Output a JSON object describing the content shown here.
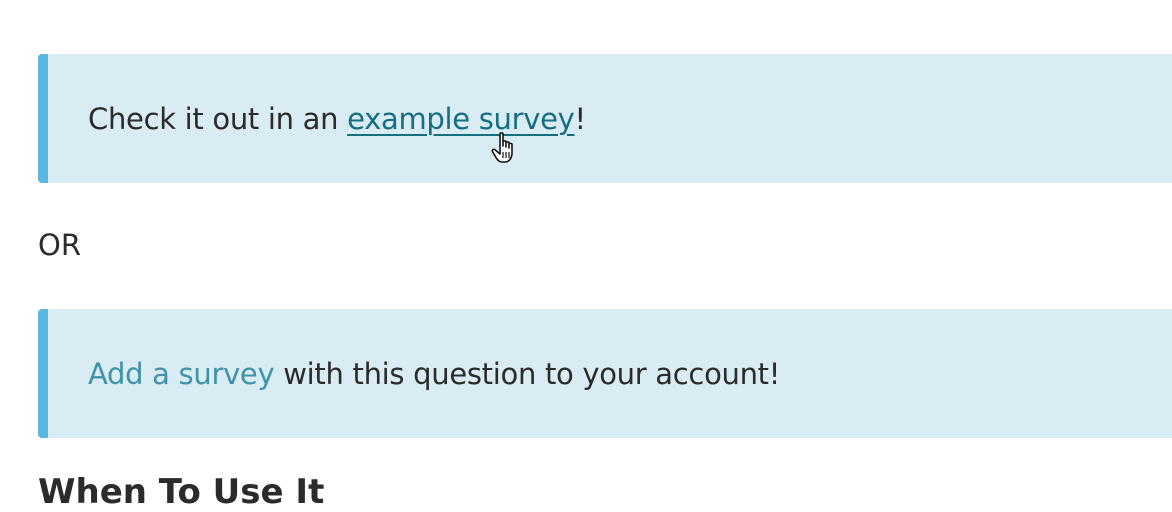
{
  "callout_example": {
    "prefix": "Check it out in an ",
    "link": "example survey",
    "suffix": "!"
  },
  "separator": "OR",
  "callout_add": {
    "link": "Add a survey",
    "suffix": " with this question to your account!"
  },
  "next_heading": "When To Use It",
  "colors": {
    "callout_bg": "#d9ebf3",
    "callout_border": "#59b6e0",
    "link_dark": "#156f80",
    "link_light": "#3f93a8",
    "text": "#2b2b2b"
  },
  "icons": {
    "cursor": "pointer-hand-icon"
  }
}
